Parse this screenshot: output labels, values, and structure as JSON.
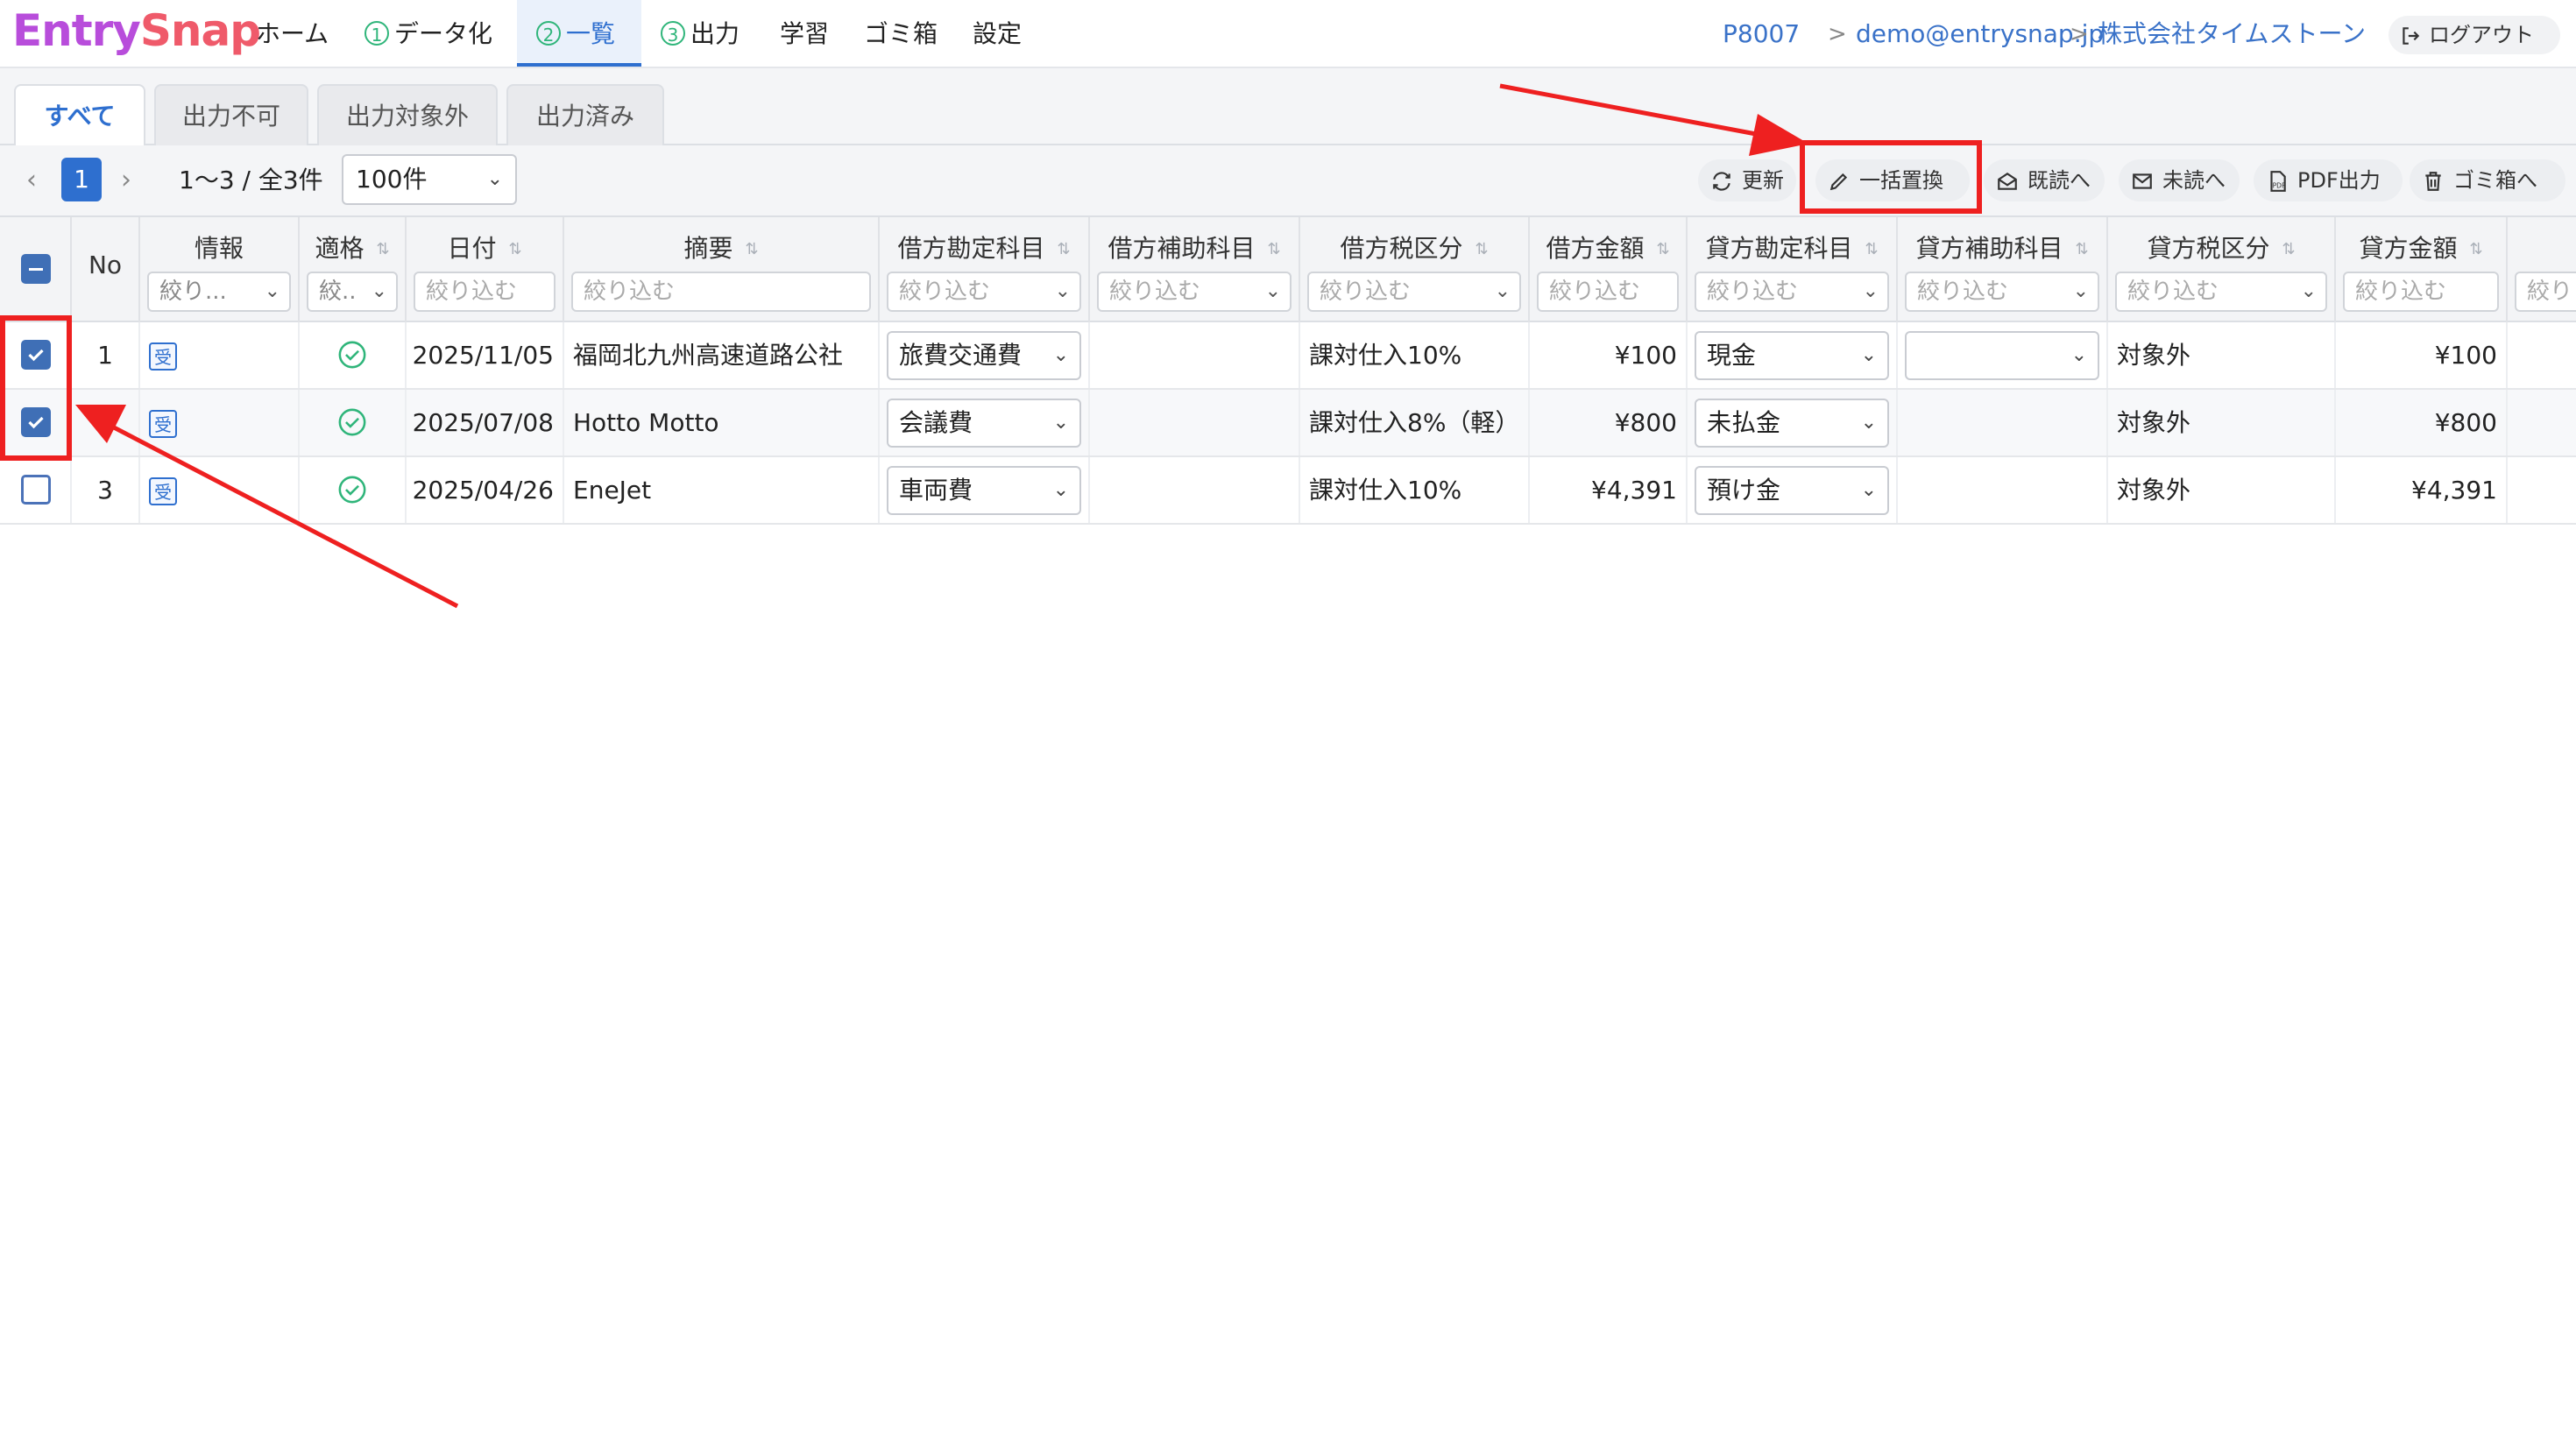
{
  "brand": {
    "prefix": "Entry",
    "suffix": "Snap"
  },
  "nav": {
    "home": "ホーム",
    "step1_num": "1",
    "step1": "データ化",
    "step2_num": "2",
    "step2": "一覧",
    "step3_num": "3",
    "step3": "出力",
    "learning": "学習",
    "trash": "ゴミ箱",
    "settings": "設定"
  },
  "breadcrumb": {
    "company_code": "P8007",
    "email": "demo@entrysnap.jp",
    "company": "株式会社タイムストーン",
    "sep": ">"
  },
  "logout_label": "ログアウト",
  "tabs": [
    "すべて",
    "出力不可",
    "出力対象外",
    "出力済み"
  ],
  "pagination": {
    "current": "1",
    "info": "1〜3 / 全3件",
    "per_page": "100件"
  },
  "toolbar": {
    "refresh": "更新",
    "bulk_replace": "一括置換",
    "mark_read": "既読へ",
    "mark_unread": "未読へ",
    "pdf": "PDF出力",
    "to_trash": "ゴミ箱へ"
  },
  "columns": {
    "no": "No",
    "info": "情報",
    "valid": "適格",
    "date": "日付",
    "summary": "摘要",
    "debit_account": "借方勘定科目",
    "debit_sub": "借方補助科目",
    "debit_tax": "借方税区分",
    "debit_amount": "借方金額",
    "credit_account": "貸方勘定科目",
    "credit_sub": "貸方補助科目",
    "credit_tax": "貸方税区分",
    "credit_amount": "貸方金額"
  },
  "filters": {
    "narrow": "絞り込む",
    "narrow_short": "絞り...",
    "narrow_tiny": "絞..",
    "narrow_cut": "絞り"
  },
  "rows": [
    {
      "no": "1",
      "badge": "受",
      "date": "2025/11/05",
      "summary": "福岡北九州高速道路公社",
      "debit_account": "旅費交通費",
      "debit_sub": "",
      "debit_tax": "課対仕入10%",
      "debit_amount": "¥100",
      "credit_account": "現金",
      "credit_sub": "",
      "credit_tax": "対象外",
      "credit_amount": "¥100",
      "checked": true
    },
    {
      "no": "2",
      "badge": "受",
      "date": "2025/07/08",
      "summary": "Hotto Motto",
      "debit_account": "会議費",
      "debit_sub": "",
      "debit_tax": "課対仕入8%（軽）",
      "debit_amount": "¥800",
      "credit_account": "未払金",
      "credit_sub": "",
      "credit_tax": "対象外",
      "credit_amount": "¥800",
      "checked": true
    },
    {
      "no": "3",
      "badge": "受",
      "date": "2025/04/26",
      "summary": "EneJet",
      "debit_account": "車両費",
      "debit_sub": "",
      "debit_tax": "課対仕入10%",
      "debit_amount": "¥4,391",
      "credit_account": "預け金",
      "credit_sub": "",
      "credit_tax": "対象外",
      "credit_amount": "¥4,391",
      "checked": false
    }
  ],
  "colors": {
    "accent": "#2e6fcf",
    "annotation": "#ee2020",
    "valid": "#2fb57a"
  }
}
